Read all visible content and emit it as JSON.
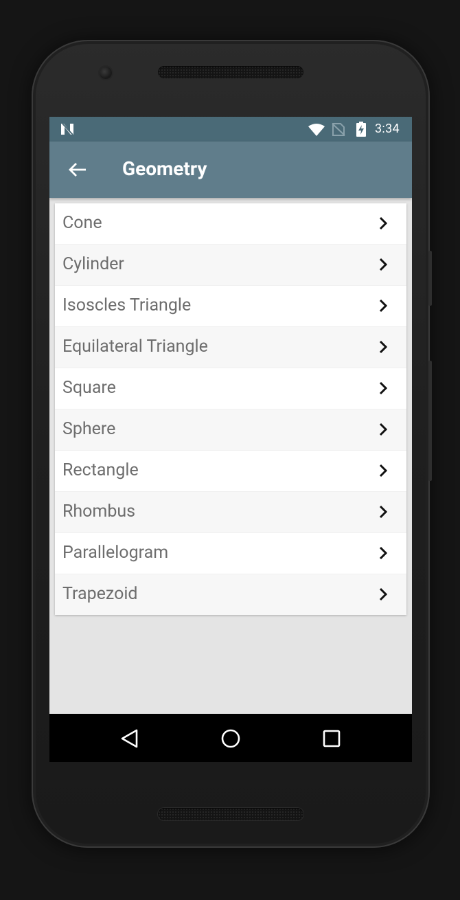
{
  "status_bar": {
    "time": "3:34",
    "icons": [
      "n-notification-icon",
      "wifi-icon",
      "no-sim-icon",
      "battery-charging-icon"
    ]
  },
  "app_bar": {
    "back_icon": "arrow-back-icon",
    "title": "Geometry",
    "color": "#607d8b",
    "status_color": "#4a6a77"
  },
  "list": {
    "items": [
      {
        "label": "Cone"
      },
      {
        "label": "Cylinder"
      },
      {
        "label": "Isoscles Triangle"
      },
      {
        "label": "Equilateral Triangle"
      },
      {
        "label": "Square"
      },
      {
        "label": "Sphere"
      },
      {
        "label": "Rectangle"
      },
      {
        "label": "Rhombus"
      },
      {
        "label": "Parallelogram"
      },
      {
        "label": "Trapezoid"
      }
    ],
    "chevron_icon": "chevron-right-icon"
  },
  "nav_bar": {
    "buttons": [
      "back-triangle-icon",
      "home-circle-icon",
      "recents-square-icon"
    ]
  }
}
